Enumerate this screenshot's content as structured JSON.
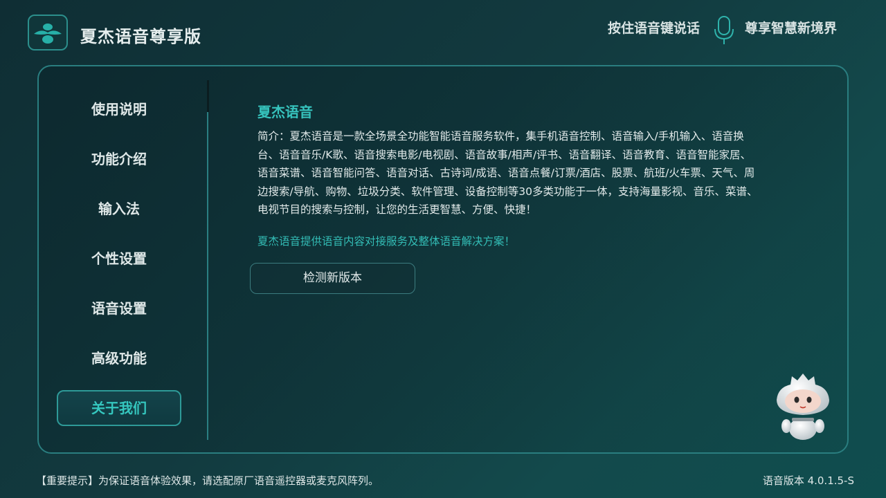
{
  "header": {
    "app_title": "夏杰语音尊享版",
    "voice_hint": "按住语音键说话",
    "slogan": "尊享智慧新境界",
    "logo_icon": "xiajie-logo-icon",
    "mic_icon": "microphone-icon"
  },
  "sidebar": {
    "items": [
      {
        "label": "使用说明",
        "active": false
      },
      {
        "label": "功能介绍",
        "active": false
      },
      {
        "label": "输入法",
        "active": false
      },
      {
        "label": "个性设置",
        "active": false
      },
      {
        "label": "语音设置",
        "active": false
      },
      {
        "label": "高级功能",
        "active": false
      },
      {
        "label": "关于我们",
        "active": true
      }
    ]
  },
  "content": {
    "title": "夏杰语音",
    "description_lines": [
      "简介：夏杰语音是一款全场景全功能智能语音服务软件，集手机语音控制、语音输入/手机输入、语音换",
      "台、语音音乐/K歌、语音搜索电影/电视剧、语音故事/相声/评书、语音翻译、语音教育、语音智能家居、",
      "语音菜谱、语音智能问答、语音对话、古诗词/成语、语音点餐/订票/酒店、股票、航班/火车票、天气、周",
      "边搜索/导航、购物、垃圾分类、软件管理、设备控制等30多类功能于一体，支持海量影视、音乐、菜谱、",
      "电视节目的搜索与控制，让您的生活更智慧、方便、快捷！"
    ],
    "tagline": "夏杰语音提供语音内容对接服务及整体语音解决方案！",
    "check_button_label": "检测新版本"
  },
  "footer": {
    "notice": "【重要提示】为保证语音体验效果，请选配原厂语音遥控器或麦克风阵列。",
    "version": "语音版本 4.0.1.5-S"
  },
  "colors": {
    "accent": "#36c3bd",
    "background": "#123a3f",
    "panel_border": "#2a7e80"
  }
}
